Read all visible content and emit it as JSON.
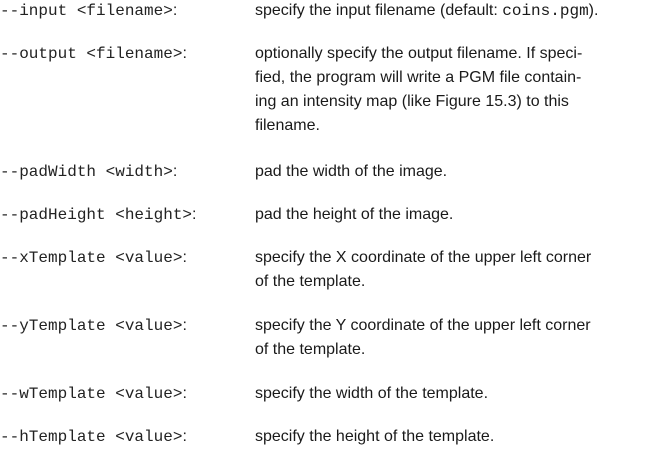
{
  "options": [
    {
      "flag": "--input <filename>",
      "colon": ":",
      "desc_lines": [
        {
          "before": "specify the input filename (default: ",
          "code": "coins.pgm",
          "after": ")."
        }
      ]
    },
    {
      "flag": "--output <filename>",
      "colon": ":",
      "desc_lines": [
        {
          "text": "optionally specify the output filename. If speci-"
        },
        {
          "text": "fied, the program will write a PGM file contain-"
        },
        {
          "text": "ing an intensity map (like Figure 15.3) to this"
        },
        {
          "text": "filename."
        }
      ]
    },
    {
      "flag": "--padWidth <width>",
      "colon": ":",
      "desc_lines": [
        {
          "text": "pad the width of the image."
        }
      ]
    },
    {
      "flag": "--padHeight <height>",
      "colon": ":",
      "desc_lines": [
        {
          "text": "pad the height of the image."
        }
      ]
    },
    {
      "flag": "--xTemplate <value>",
      "colon": ":",
      "desc_lines": [
        {
          "text": "specify the X coordinate of the upper left corner"
        },
        {
          "text": "of the template."
        }
      ]
    },
    {
      "flag": "--yTemplate <value>",
      "colon": ":",
      "desc_lines": [
        {
          "text": "specify the Y coordinate of the upper left corner"
        },
        {
          "text": "of the template."
        }
      ]
    },
    {
      "flag": "--wTemplate <value>",
      "colon": ":",
      "desc_lines": [
        {
          "text": "specify the width of the template."
        }
      ]
    },
    {
      "flag": "--hTemplate <value>",
      "colon": ":",
      "desc_lines": [
        {
          "text": "specify the height of the template."
        }
      ]
    }
  ]
}
